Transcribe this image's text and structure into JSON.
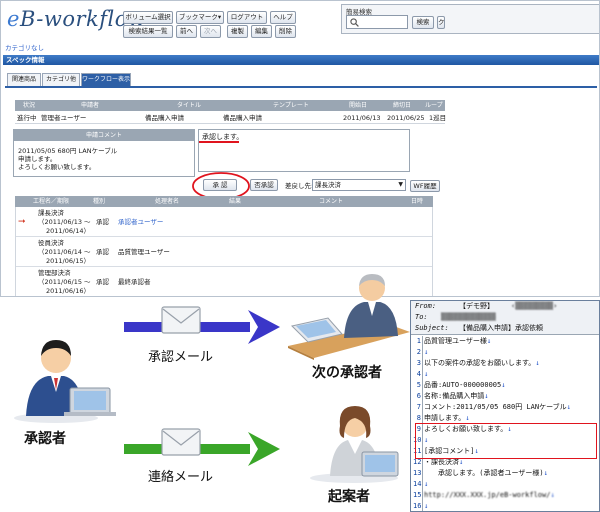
{
  "app": {
    "logo": "eB-workflow",
    "logo_e": "e",
    "logo_rest": "B-workflow",
    "toolbar_row1": [
      "ボリューム選択",
      "ブックマーク▾",
      "ログアウト",
      "ヘルプ"
    ],
    "toolbar_row2": [
      "検索結果一覧",
      "前へ",
      "次へ",
      "複製",
      "編集",
      "削除"
    ],
    "search_label": "簡易検索",
    "search_button": "検索",
    "search_button2": "ク",
    "category_none": "カテゴリなし",
    "spec_header": "スペック情報",
    "tabs": [
      "関連商品",
      "カテゴリ他",
      "ワークフロー表示"
    ],
    "flow_table": {
      "headers": [
        "状況",
        "申請者",
        "タイトル",
        "テンプレート",
        "開始日",
        "締切日",
        "ループ"
      ],
      "row": [
        "進行中",
        "管理者ユーザー",
        "備品購入申請",
        "備品購入申請",
        "2011/06/13",
        "2011/06/25",
        "1巡目"
      ]
    },
    "request_comment_header": "申請コメント",
    "request_comment": [
      "2011/05/05 680円 LANケーブル",
      "申請します。",
      "よろしくお願い致します。"
    ],
    "approval_input": "承認します。",
    "approve_button": "承 認",
    "reject_button": "否承認",
    "sendback_label": "差戻し先:",
    "sendback_value": "課長決済",
    "wf_history_button": "WF履歴",
    "grid_headers": [
      "工程名／期限",
      "種別",
      "処理者名",
      "結果",
      "コメント",
      "日時"
    ],
    "grid_rows": [
      {
        "step": "課長決済",
        "period": "（2011/06/13 ～",
        "period2": "2011/06/14）",
        "type": "承認",
        "processor": "承認者ユーザー"
      },
      {
        "step": "役員決済",
        "period": "（2011/06/14 ～",
        "period2": "2011/06/15）",
        "type": "承認",
        "processor": "品質管理ユーザー"
      },
      {
        "step": "管理部決済",
        "period": "（2011/06/15 ～",
        "period2": "2011/06/16）",
        "type": "承認",
        "processor": "最終承認者"
      }
    ]
  },
  "diagram": {
    "approval_mail": "承認メール",
    "contact_mail": "連絡メール",
    "approver": "承認者",
    "next_approver": "次の承認者",
    "applicant": "起案者"
  },
  "mail": {
    "from_label": "From:",
    "from_value": "【デモ野】",
    "to_label": "To:",
    "subject_label": "Subject:",
    "subject_value": "【備品購入申請】承認依頼",
    "lines": [
      {
        "num": "1",
        "text": "品質管理ユーザー様"
      },
      {
        "num": "2",
        "text": ""
      },
      {
        "num": "3",
        "text": "以下の案件の承認をお願いします。"
      },
      {
        "num": "4",
        "text": ""
      },
      {
        "num": "5",
        "text": "品番:AUTO-000000005"
      },
      {
        "num": "6",
        "text": "名称:備品購入申請"
      },
      {
        "num": "7",
        "text": "コメント:2011/05/05 680円 LANケーブル"
      },
      {
        "num": "8",
        "text": "申請します。"
      },
      {
        "num": "9",
        "text": "よろしくお願い致します。"
      },
      {
        "num": "10",
        "text": ""
      },
      {
        "num": "11",
        "text": "[承認コメント]"
      },
      {
        "num": "12",
        "text": "・課長決済"
      },
      {
        "num": "13",
        "text": "　　承認します。(承認者ユーザー様)"
      },
      {
        "num": "14",
        "text": ""
      },
      {
        "num": "15",
        "text": "http://XXX.XXX.jp/eB-workflow/"
      },
      {
        "num": "16",
        "text": ""
      }
    ]
  },
  "colors": {
    "blue_arrow": "#3a36c8",
    "green_arrow": "#3aa629",
    "red_highlight": "#e0141e",
    "header_blue": "#2d5fa6"
  }
}
